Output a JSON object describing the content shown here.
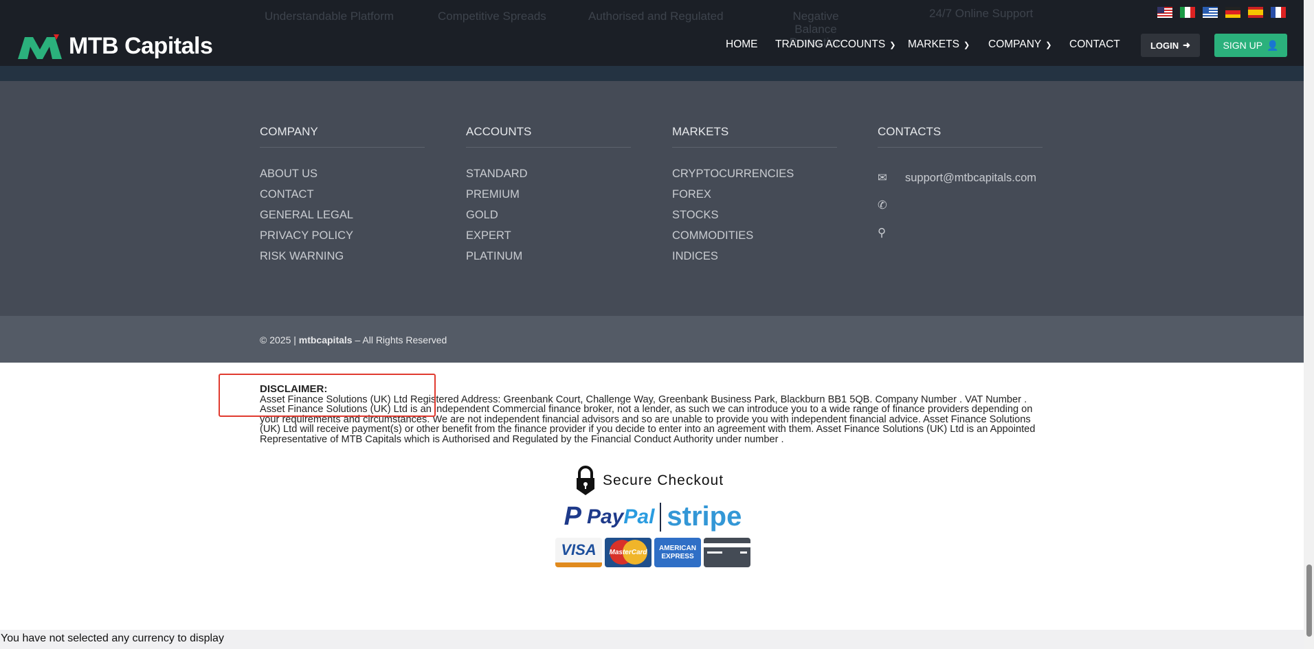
{
  "topbar": {
    "features": [
      "Understandable Platform",
      "Competitive Spreads",
      "Authorised and Regulated",
      "Negative Balance Protection",
      "24/7 Online Support"
    ],
    "flags": [
      "us",
      "it",
      "gr",
      "de",
      "es",
      "fr"
    ]
  },
  "header": {
    "logo": "MTB Capitals",
    "nav": [
      "HOME",
      "TRADING ACCOUNTS",
      "MARKETS",
      "COMPANY",
      "CONTACT"
    ],
    "login": "LOGIN",
    "signup": "SIGN UP",
    "accent": "#2bb17c"
  },
  "footer": {
    "company": {
      "title": "COMPANY",
      "items": [
        "ABOUT US",
        "CONTACT",
        "GENERAL LEGAL",
        "PRIVACY POLICY",
        "RISK WARNING"
      ]
    },
    "accounts": {
      "title": "ACCOUNTS",
      "items": [
        "STANDARD",
        "PREMIUM",
        "GOLD",
        "EXPERT",
        "PLATINUM"
      ]
    },
    "markets": {
      "title": "MARKETS",
      "items": [
        "CRYPTOCURRENCIES",
        "FOREX",
        "STOCKS",
        "COMMODITIES",
        "INDICES"
      ]
    },
    "contacts": {
      "title": "CONTACTS",
      "email": "support@mtbcapitals.com"
    },
    "copyright_prefix": "© 2025 | ",
    "copyright_brand": "mtbcapitals",
    "copyright_suffix": " – All Rights Reserved"
  },
  "disclaimer": {
    "title": "DISCLAIMER:",
    "text": "Asset Finance Solutions (UK) Ltd Registered Address: Greenbank Court, Challenge Way, Greenbank Business Park, Blackburn BB1 5QB. Company Number . VAT Number . Asset Finance Solutions (UK) Ltd is an independent Commercial finance broker, not a lender, as such we can introduce you to a wide range of finance providers depending on your requirements and circumstances. We are not independent financial advisors and so are unable to provide you with independent financial advice. Asset Finance Solutions (UK) Ltd will receive payment(s) or other benefit from the finance provider if you decide to enter into an agreement with them. Asset Finance Solutions (UK) Ltd is an Appointed Representative of MTB Capitals which is Authorised and Regulated by the Financial Conduct Authority under number ."
  },
  "payment": {
    "secure": "Secure Checkout",
    "paypal_a": "Pay",
    "paypal_b": "Pal",
    "stripe": "stripe",
    "visa": "VISA",
    "mastercard": "MasterCard",
    "amex_a": "AMERICAN",
    "amex_b": "EXPRESS"
  },
  "status": "You have not selected any currency to display"
}
